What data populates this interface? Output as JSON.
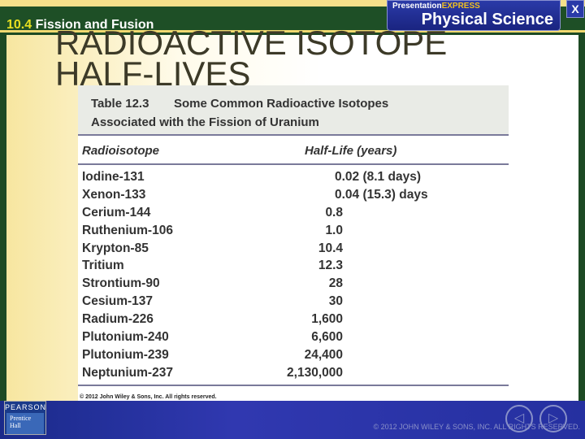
{
  "header": {
    "section_number": "10.4",
    "section_title": "Fission and Fusion",
    "brand_top_a": "Presentation",
    "brand_top_b": "EXPRESS",
    "brand_main": "Physical Science",
    "close_label": "X"
  },
  "slide_title": "RADIOACTIVE ISOTOPE HALF-LIVES",
  "table": {
    "label": "Table 12.3",
    "title_line1": "Some Common Radioactive Isotopes",
    "title_line2": "Associated with the Fission of Uranium",
    "columns": [
      "Radioisotope",
      "Half-Life (years)"
    ],
    "rows": [
      {
        "name": "Iodine-131",
        "value": "0.02 (8.1 days)"
      },
      {
        "name": "Xenon-133",
        "value": "0.04 (15.3) days"
      },
      {
        "name": "Cerium-144",
        "value": "0.8"
      },
      {
        "name": "Ruthenium-106",
        "value": "1.0"
      },
      {
        "name": "Krypton-85",
        "value": "10.4"
      },
      {
        "name": "Tritium",
        "value": "12.3"
      },
      {
        "name": "Strontium-90",
        "value": "28"
      },
      {
        "name": "Cesium-137",
        "value": "30"
      },
      {
        "name": "Radium-226",
        "value": "1,600"
      },
      {
        "name": "Plutonium-240",
        "value": "6,600"
      },
      {
        "name": "Plutonium-239",
        "value": "24,400"
      },
      {
        "name": "Neptunium-237",
        "value": "2,130,000"
      }
    ],
    "copyright": "© 2012 John Wiley & Sons, Inc. All rights reserved."
  },
  "footer": {
    "logo_top": "PEARSON",
    "logo_bottom": "Prentice Hall",
    "copyright": "© 2012 JOHN WILEY & SONS, INC. ALL RIGHTS RESERVED.",
    "prev": "◁",
    "next": "▷"
  }
}
